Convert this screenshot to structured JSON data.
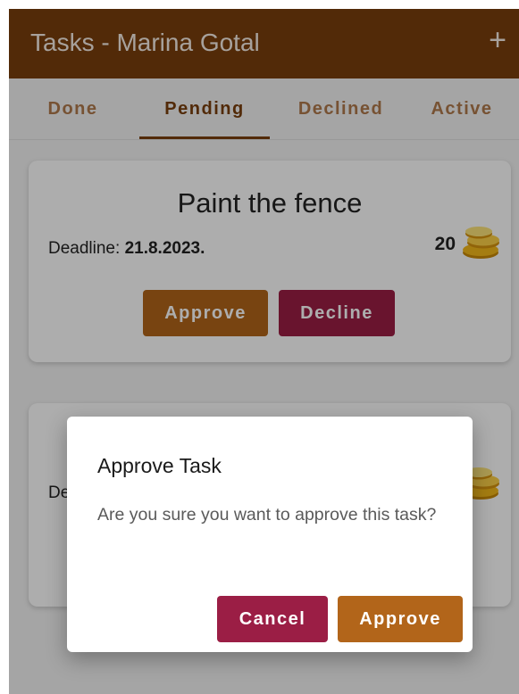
{
  "header": {
    "title": "Tasks - Marina Gotal",
    "add_icon": "plus-icon"
  },
  "tabs": [
    {
      "label": "Done"
    },
    {
      "label": "Pending"
    },
    {
      "label": "Declined"
    },
    {
      "label": "Active"
    }
  ],
  "tasks": [
    {
      "title": "Paint the fence",
      "deadline_label": "Deadline: ",
      "deadline_value": "21.8.2023.",
      "points": "20",
      "approve_label": "Approve",
      "decline_label": "Decline"
    },
    {
      "deadline_label": "De"
    }
  ],
  "dialog": {
    "title": "Approve Task",
    "message": "Are you sure you want to approve this task?",
    "cancel_label": "Cancel",
    "approve_label": "Approve"
  },
  "colors": {
    "primary": "#7a3f0c",
    "approve": "#b2651a",
    "decline": "#9b1e45"
  }
}
